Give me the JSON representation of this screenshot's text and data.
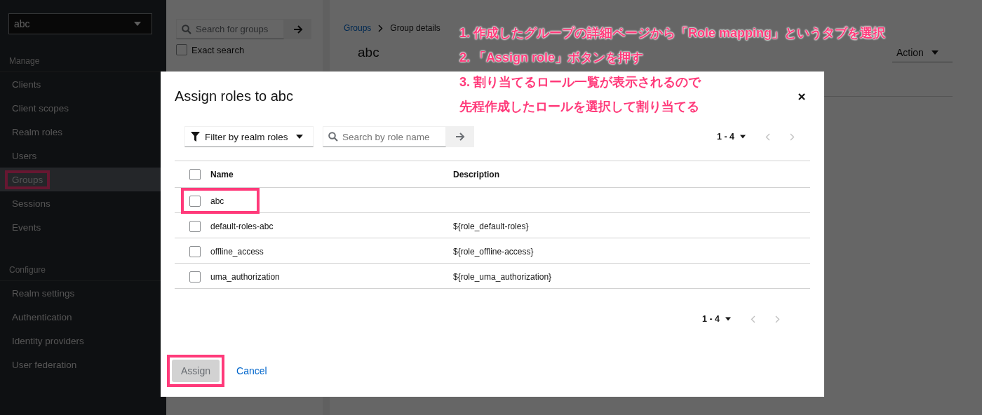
{
  "sidebar": {
    "realm_select": "abc",
    "sections": [
      {
        "title": "Manage",
        "items": [
          {
            "label": "Clients",
            "selected": false,
            "highlighted": false
          },
          {
            "label": "Client scopes",
            "selected": false,
            "highlighted": false
          },
          {
            "label": "Realm roles",
            "selected": false,
            "highlighted": false
          },
          {
            "label": "Users",
            "selected": false,
            "highlighted": false
          },
          {
            "label": "Groups",
            "selected": true,
            "highlighted": true
          },
          {
            "label": "Sessions",
            "selected": false,
            "highlighted": false
          },
          {
            "label": "Events",
            "selected": false,
            "highlighted": false
          }
        ]
      },
      {
        "title": "Configure",
        "items": [
          {
            "label": "Realm settings",
            "selected": false,
            "highlighted": false
          },
          {
            "label": "Authentication",
            "selected": false,
            "highlighted": false
          },
          {
            "label": "Identity providers",
            "selected": false,
            "highlighted": false
          },
          {
            "label": "User federation",
            "selected": false,
            "highlighted": false
          }
        ]
      }
    ]
  },
  "groups_panel": {
    "search_placeholder": "Search for groups",
    "exact_search": {
      "label": "Exact search",
      "checked": false
    }
  },
  "breadcrumb": [
    "Groups",
    "Group details"
  ],
  "page_title": "abc",
  "action_button": "Action",
  "dialog": {
    "title": "Assign roles to abc",
    "filter": "Filter by realm roles",
    "search_placeholder": "Search by role name",
    "pagination_top": "1 - 4",
    "pagination_bottom": "1 - 4",
    "columns": [
      "Name",
      "Description"
    ],
    "select_all_checked": false,
    "rows": [
      {
        "name": "abc",
        "checked": false,
        "highlighted": true
      },
      {
        "name": "default-roles-abc",
        "description": "${role_default-roles}",
        "checked": false,
        "highlighted": false
      },
      {
        "name": "offline_access",
        "description": "${role_offline-access}",
        "checked": false,
        "highlighted": false
      },
      {
        "name": "uma_authorization",
        "description": "${role_uma_authorization}",
        "checked": false,
        "highlighted": false
      }
    ],
    "assign_button": {
      "label": "Assign",
      "disabled": true,
      "highlighted": true
    },
    "cancel_link": "Cancel"
  },
  "annotations": [
    "1. 作成したグループの詳細ページから「Role mapping」というタブを選択",
    "2. 「Assign role」ボタンを押す",
    "3. 割り当てるロール一覧が表示されるので",
    "先程作成したロールを選択して割り当てる"
  ]
}
